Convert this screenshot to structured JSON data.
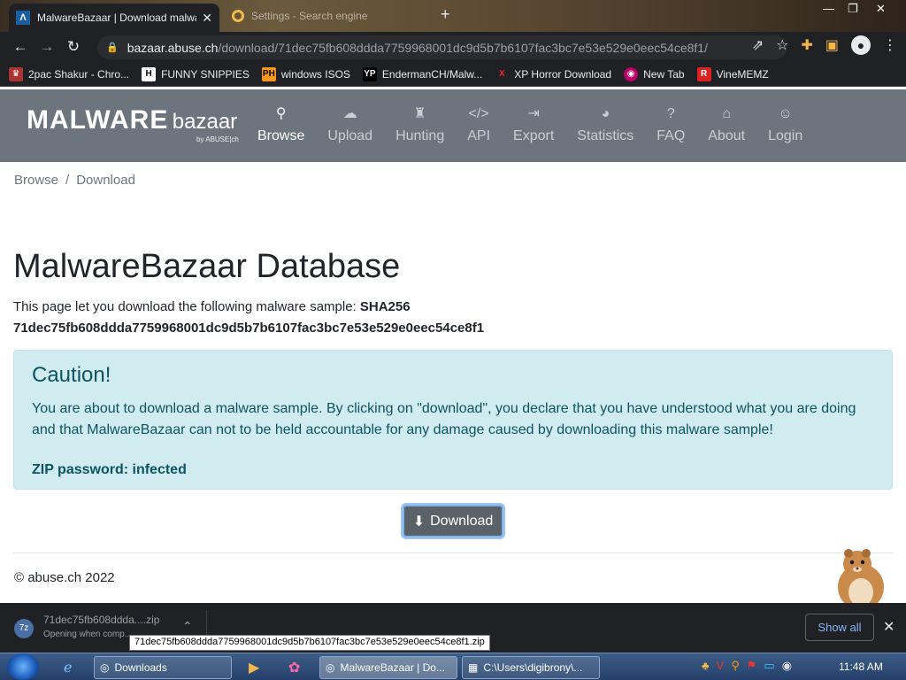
{
  "browser": {
    "tabs": [
      {
        "title": "MalwareBazaar | Download malware samples",
        "active": true
      },
      {
        "title": "Settings - Search engine",
        "active": false
      }
    ],
    "url_host": "bazaar.abuse.ch",
    "url_path": "/download/71dec75fb608ddda7759968001dc9d5b7b6107fac3bc7e53e529e0eec54ce8f1/",
    "bookmarks": [
      {
        "label": "2pac Shakur - Chro...",
        "icon": "crown-icon"
      },
      {
        "label": "FUNNY SNIPPIES",
        "icon": "H"
      },
      {
        "label": "windows ISOS",
        "icon": "PH"
      },
      {
        "label": "EndermanCH/Malw...",
        "icon": "YP"
      },
      {
        "label": "XP Horror Download",
        "icon": "X"
      },
      {
        "label": "New Tab",
        "icon": "globe-icon"
      },
      {
        "label": "VineMEMZ",
        "icon": "R"
      }
    ]
  },
  "site": {
    "logo_main": "MALWARE",
    "logo_sub": "bazaar",
    "logo_by": "by ABUSE|ch",
    "nav": [
      {
        "label": "Browse",
        "icon": "search-icon",
        "active": true
      },
      {
        "label": "Upload",
        "icon": "cloud-upload-icon",
        "active": false
      },
      {
        "label": "Hunting",
        "icon": "hunting-icon",
        "active": false
      },
      {
        "label": "API",
        "icon": "code-icon",
        "active": false
      },
      {
        "label": "Export",
        "icon": "export-icon",
        "active": false
      },
      {
        "label": "Statistics",
        "icon": "pie-chart-icon",
        "active": false
      },
      {
        "label": "FAQ",
        "icon": "question-icon",
        "active": false
      },
      {
        "label": "About",
        "icon": "building-icon",
        "active": false
      },
      {
        "label": "Login",
        "icon": "user-icon",
        "active": false
      }
    ]
  },
  "breadcrumb": {
    "first": "Browse",
    "sep": "/",
    "second": "Download"
  },
  "page": {
    "title": "MalwareBazaar Database",
    "intro": "This page let you download the following malware sample:",
    "hash_label": "SHA256",
    "hash": "71dec75fb608ddda7759968001dc9d5b7b6107fac3bc7e53e529e0eec54ce8f1"
  },
  "alert": {
    "heading": "Caution!",
    "body": "You are about to download a malware sample. By clicking on \"download\", you declare that you have understood what you are doing and that MalwareBazaar can not to be held accountable for any damage caused by downloading this malware sample!",
    "password": "ZIP password: infected"
  },
  "download_button": "Download",
  "footer": {
    "copyright": "© abuse.ch 2022"
  },
  "download_shelf": {
    "filename": "71dec75fb608ddda....zip",
    "status": "Opening when comp...",
    "tooltip": "71dec75fb608ddda7759968001dc9d5b7b6107fac3bc7e53e529e0eec54ce8f1.zip",
    "show_all": "Show all"
  },
  "taskbar": {
    "windows": [
      {
        "label": "Downloads",
        "active": false
      },
      {
        "label": "MalwareBazaar | Do...",
        "active": true
      },
      {
        "label": "C:\\Users\\digibrony\\...",
        "active": false
      }
    ],
    "clock": "11:48 AM"
  },
  "colors": {
    "header_bg": "#6c757d",
    "alert_bg": "#d1ecf1",
    "alert_text": "#0c5460",
    "button_bg": "#5a6268"
  }
}
